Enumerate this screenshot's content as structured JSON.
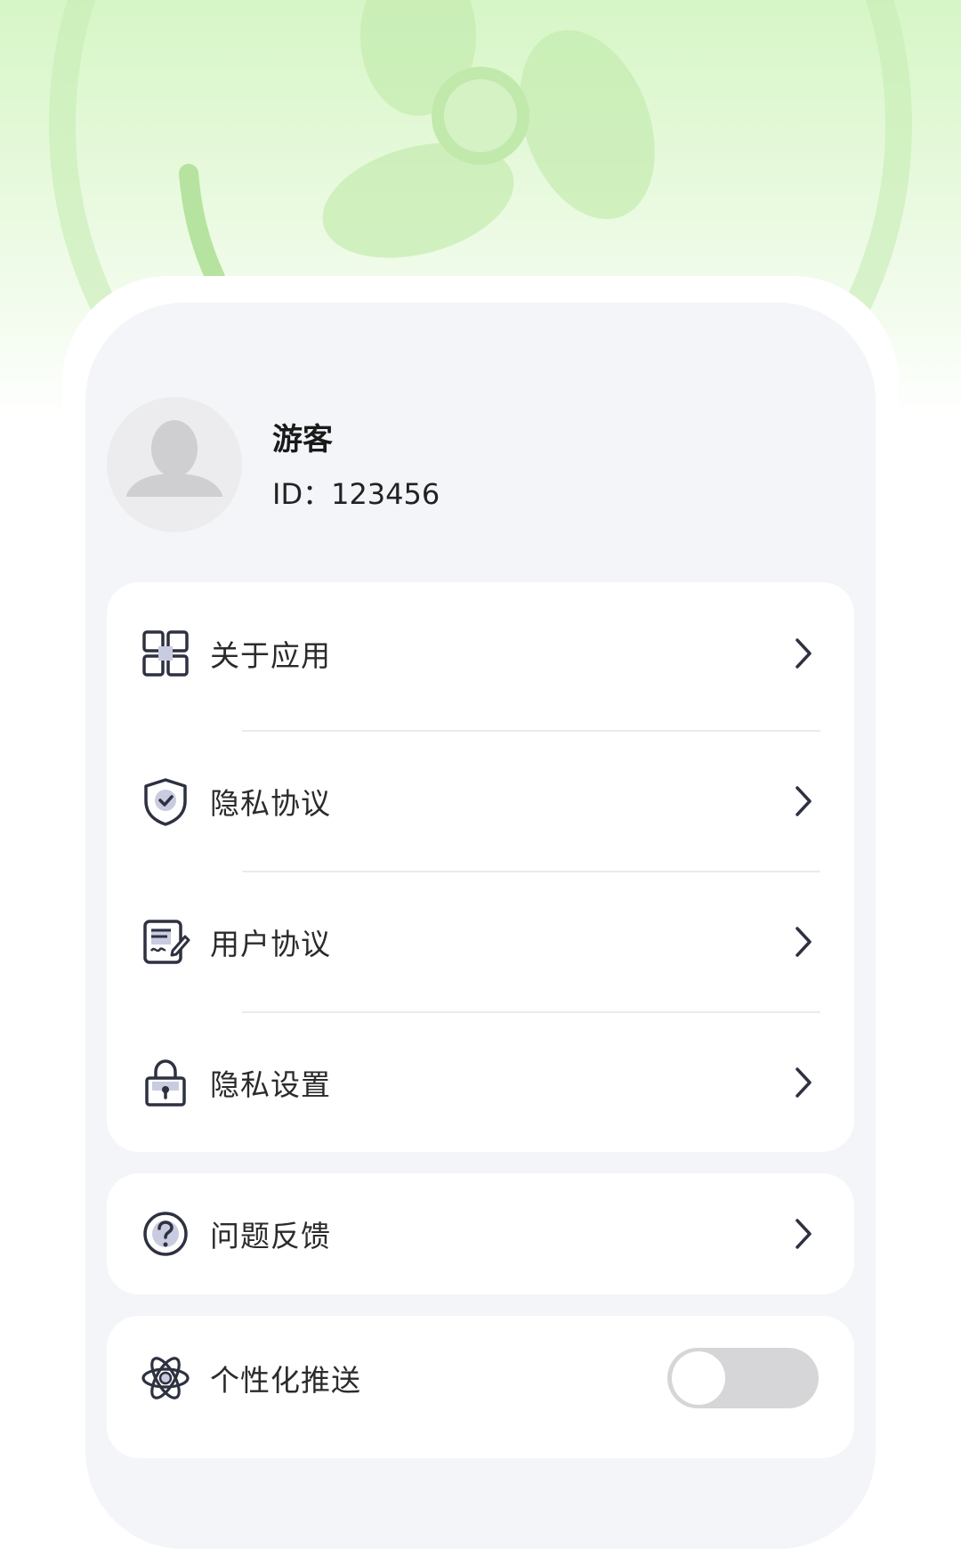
{
  "profile": {
    "name": "游客",
    "id_text": "ID：123456"
  },
  "menu_group_1": [
    {
      "label": "关于应用",
      "icon": "grid-icon"
    },
    {
      "label": "隐私协议",
      "icon": "shield-check-icon"
    },
    {
      "label": "用户协议",
      "icon": "document-sign-icon"
    },
    {
      "label": "隐私设置",
      "icon": "lock-icon"
    }
  ],
  "menu_group_2": [
    {
      "label": "问题反馈",
      "icon": "question-circle-icon"
    }
  ],
  "menu_group_3": [
    {
      "label": "个性化推送",
      "icon": "atom-icon",
      "toggle_on": false
    }
  ],
  "colors": {
    "header_green": "#d6f6c6",
    "fan_green": "#bde8a8",
    "icon_dark": "#2e3140",
    "icon_fill": "#c9cbe0",
    "toggle_off": "#d6d6d8"
  }
}
